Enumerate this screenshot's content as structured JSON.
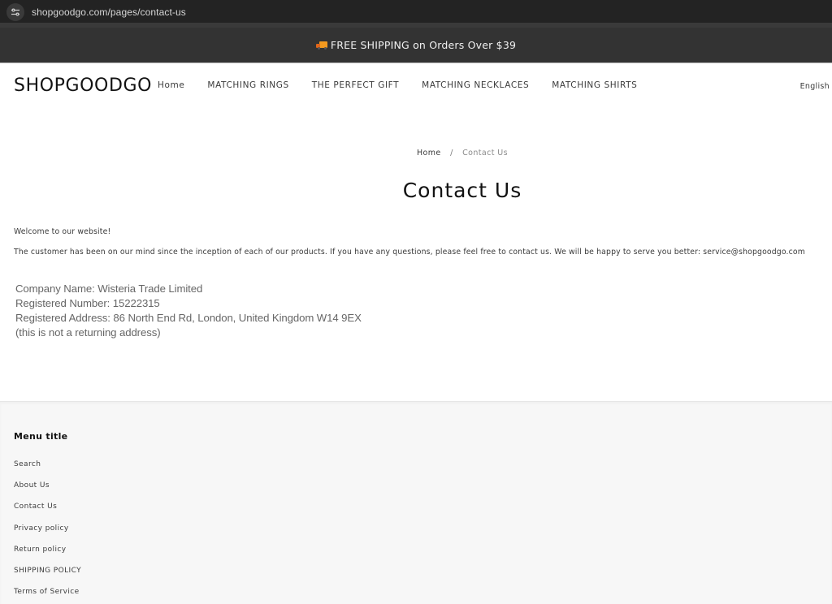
{
  "browser": {
    "url": "shopgoodgo.com/pages/contact-us",
    "site_icon": "site-settings-icon"
  },
  "announcement": {
    "icon": "delivery-truck-icon",
    "text": "FREE SHIPPING on Orders Over $39"
  },
  "header": {
    "logo": "SHOPGOODGO",
    "nav": [
      {
        "label": "Home"
      },
      {
        "label": "MATCHING RINGS"
      },
      {
        "label": "THE PERFECT GIFT"
      },
      {
        "label": "MATCHING NECKLACES"
      },
      {
        "label": "MATCHING SHIRTS"
      }
    ],
    "language": "English"
  },
  "breadcrumb": {
    "home": "Home",
    "separator": "/",
    "current": "Contact Us"
  },
  "main": {
    "title": "Contact Us",
    "welcome": "Welcome to our website!",
    "intro": "The customer has been on our mind since the inception of each of our products. If you have any questions, please feel free to contact us. We will be happy to serve you better: service@shopgoodgo.com",
    "company_lines": [
      "Company Name: Wisteria Trade Limited",
      "Registered Number: 15222315",
      "Registered Address: 86 North End Rd, London, United Kingdom W14 9EX",
      "(this is not a returning address)"
    ]
  },
  "footer": {
    "menu_title": "Menu title",
    "links": [
      {
        "label": "Search"
      },
      {
        "label": "About Us"
      },
      {
        "label": "Contact Us"
      },
      {
        "label": "Privacy policy"
      },
      {
        "label": "Return policy"
      },
      {
        "label": "SHIPPING POLICY"
      },
      {
        "label": "Terms of Service"
      }
    ]
  },
  "colors": {
    "announcement_bg": "#333333",
    "browser_bg": "#232323",
    "footer_bg": "#f7f7f7",
    "text_primary": "#121212",
    "text_secondary": "#3b3b3b"
  }
}
